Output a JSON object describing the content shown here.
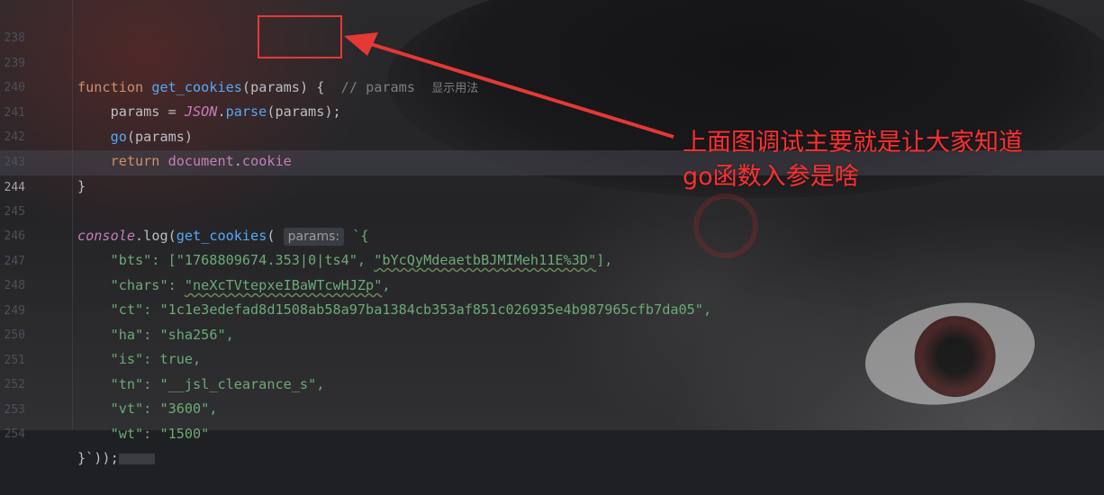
{
  "annotation": {
    "line1": "上面图调试主要就是让大家知道",
    "line2": "go函数入参是啥",
    "color": "#ff2f2f"
  },
  "editor": {
    "lines": [
      {
        "n": "238"
      },
      {
        "n": "239",
        "tokens": {
          "kw": "function",
          "fn": "get_cookies",
          "open": "(",
          "param": "params",
          "close": ") {",
          "comment": "// params",
          "usage": "显示用法"
        }
      },
      {
        "n": "240",
        "tokens": {
          "a": "params = ",
          "glob": "JSON",
          "dot": ".",
          "fn": "parse",
          "rest": "(params);"
        }
      },
      {
        "n": "241",
        "tokens": {
          "fn": "go",
          "rest": "(params)"
        }
      },
      {
        "n": "242",
        "tokens": {
          "kw": "return",
          "prop": "document",
          "dot": ".",
          "prop2": "cookie"
        }
      },
      {
        "n": "243",
        "tokens": {
          "a": "}"
        }
      },
      {
        "n": "244"
      },
      {
        "n": "245",
        "tokens": {
          "glob": "console",
          "dot": ".",
          "fn": "log",
          "open": "(",
          "fn2": "get_cookies",
          "open2": "(",
          "hint": "params:",
          "rest": "`{"
        }
      },
      {
        "n": "246",
        "tokens": {
          "key": "\"bts\"",
          "rest": ": [",
          "s1": "\"1768809674.353|0|ts4\"",
          "comma": ", ",
          "s2": "\"bYcQyMdeaetbBJMIMeh11E%3D\"",
          "end": "],"
        }
      },
      {
        "n": "247",
        "tokens": {
          "key": "\"chars\"",
          "rest": ": ",
          "s1": "\"neXcTVtepxeIBaWTcwHJZp\"",
          "end": ","
        }
      },
      {
        "n": "248",
        "tokens": {
          "key": "\"ct\"",
          "rest": ": ",
          "s1": "\"1c1e3edefad8d1508ab58a97ba1384cb353af851c026935e4b987965cfb7da05\"",
          "end": ","
        }
      },
      {
        "n": "249",
        "tokens": {
          "key": "\"ha\"",
          "rest": ": ",
          "s1": "\"sha256\"",
          "end": ","
        }
      },
      {
        "n": "250",
        "tokens": {
          "key": "\"is\"",
          "rest": ": ",
          "s1": "true",
          "end": ","
        }
      },
      {
        "n": "251",
        "tokens": {
          "key": "\"tn\"",
          "rest": ": ",
          "s1": "\"__jsl_clearance_s\"",
          "end": ","
        }
      },
      {
        "n": "252",
        "tokens": {
          "key": "\"vt\"",
          "rest": ": ",
          "s1": "\"3600\"",
          "end": ","
        }
      },
      {
        "n": "253",
        "tokens": {
          "key": "\"wt\"",
          "rest": ": ",
          "s1": "\"1500\""
        }
      },
      {
        "n": "254",
        "tokens": {
          "a": "}`));"
        }
      }
    ]
  }
}
